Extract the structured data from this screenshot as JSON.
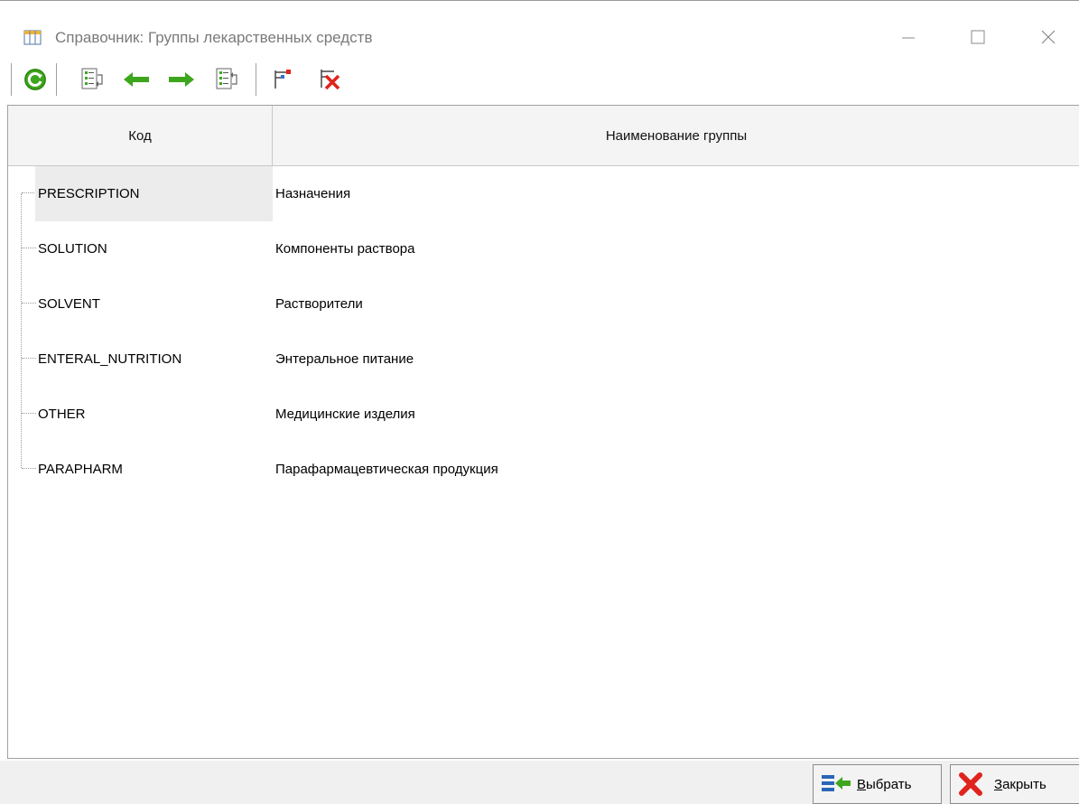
{
  "window": {
    "title": "Справочник: Группы лекарственных средств",
    "icon": "table-icon",
    "controls": [
      "minimize-icon",
      "maximize-icon",
      "close-icon"
    ]
  },
  "toolbar": {
    "buttons": [
      "refresh-icon",
      "expand-tree-icon",
      "arrow-left-icon",
      "arrow-right-icon",
      "collapse-tree-icon",
      "filter-icon",
      "clear-filter-icon"
    ]
  },
  "grid": {
    "columns": [
      "Код",
      "Наименование группы"
    ],
    "rows": [
      {
        "code": "PRESCRIPTION",
        "name": "Назначения",
        "selected": true
      },
      {
        "code": "SOLUTION",
        "name": "Компоненты раствора"
      },
      {
        "code": "SOLVENT",
        "name": "Растворители"
      },
      {
        "code": "ENTERAL_NUTRITION",
        "name": "Энтеральное питание"
      },
      {
        "code": "OTHER",
        "name": "Медицинские изделия"
      },
      {
        "code": "PARAPHARM",
        "name": "Парафармацевтическая продукция"
      }
    ]
  },
  "footer": {
    "select": {
      "mnemonic": "В",
      "rest": "ыбрать"
    },
    "close": {
      "mnemonic": "З",
      "rest": "акрыть"
    }
  },
  "colors": {
    "accent_green": "#3ea61e",
    "close_red": "#e0231c",
    "selection": "#ececec"
  }
}
